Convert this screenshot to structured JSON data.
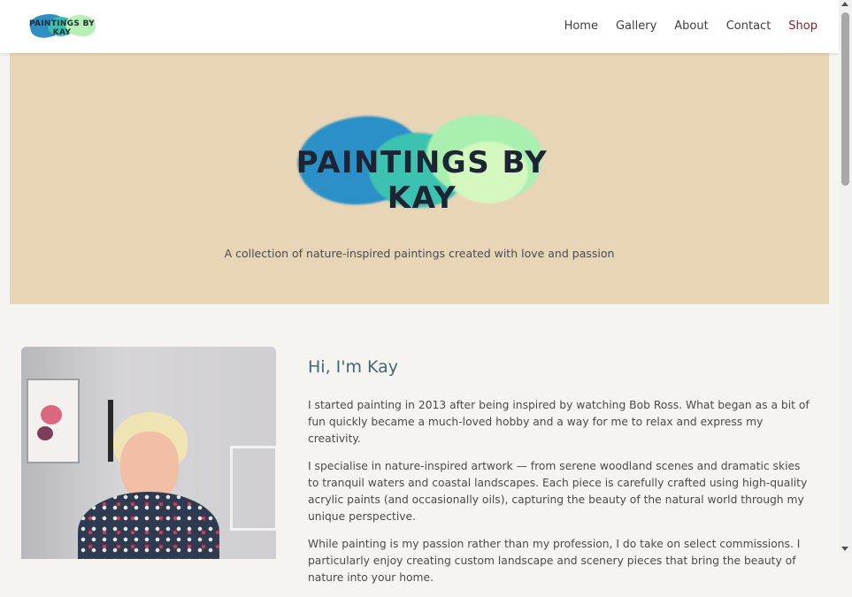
{
  "header": {
    "logo_text": "PAINTINGS BY KAY",
    "nav": [
      {
        "label": "Home"
      },
      {
        "label": "Gallery"
      },
      {
        "label": "About"
      },
      {
        "label": "Contact"
      },
      {
        "label": "Shop"
      }
    ]
  },
  "hero": {
    "logo_text": "PAINTINGS BY KAY",
    "tagline": "A collection of nature-inspired paintings created with love and passion",
    "background_color": "#e8d5b5"
  },
  "about": {
    "heading": "Hi, I'm Kay",
    "paragraphs": [
      "I started painting in 2013 after being inspired by watching Bob Ross. What began as a bit of fun quickly became a much-loved hobby and a way for me to relax and express my creativity.",
      "I specialise in nature-inspired artwork — from serene woodland scenes and dramatic skies to tranquil waters and coastal landscapes. Each piece is carefully crafted using high-quality acrylic paints (and occasionally oils), capturing the beauty of the natural world through my unique perspective.",
      "While painting is my passion rather than my profession, I do take on select commissions. I particularly enjoy creating custom landscape and scenery pieces that bring the beauty of nature into your home."
    ]
  },
  "colors": {
    "accent_shop": "#8b1e1e",
    "heading": "#3d6a73"
  }
}
